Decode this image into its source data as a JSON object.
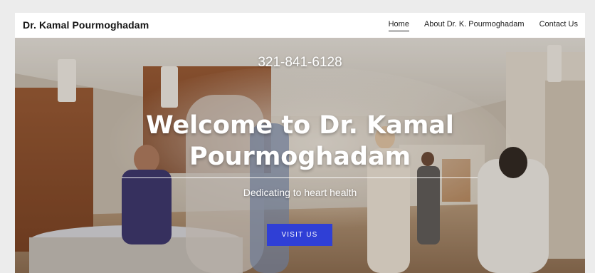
{
  "header": {
    "brand": "Dr. Kamal Pourmoghadam",
    "nav": [
      {
        "label": "Home",
        "active": true
      },
      {
        "label": "About Dr. K. Pourmoghadam",
        "active": false
      },
      {
        "label": "Contact Us",
        "active": false
      }
    ]
  },
  "hero": {
    "phone": "321-841-6128",
    "headline": "Welcome to Dr. Kamal Pourmoghadam",
    "tagline": "Dedicating to heart health",
    "cta_label": "VISIT US"
  },
  "colors": {
    "cta": "#2f3fd6",
    "header_bg": "#ffffff",
    "text_dark": "#141414"
  }
}
